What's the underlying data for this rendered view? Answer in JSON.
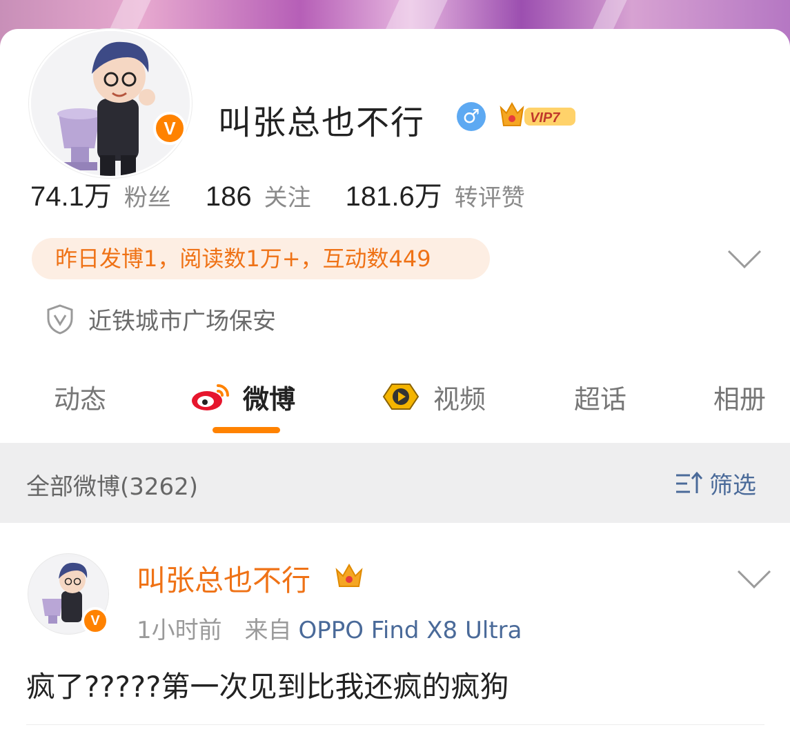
{
  "profile": {
    "name": "叫张总也不行",
    "gender_icon": "male-icon",
    "vip_label": "VIP7",
    "verified_badge": "V"
  },
  "stats": [
    {
      "value": "74.1万",
      "label": "粉丝"
    },
    {
      "value": "186",
      "label": "关注"
    },
    {
      "value": "181.6万",
      "label": "转评赞"
    }
  ],
  "activity_summary": "昨日发博1，阅读数1万+，互动数449",
  "job_title": "近铁城市广场保安",
  "tabs": [
    {
      "label": "动态",
      "icon": null
    },
    {
      "label": "微博",
      "icon": "weibo-logo-icon"
    },
    {
      "label": "视频",
      "icon": "video-play-icon"
    },
    {
      "label": "超话",
      "icon": null
    },
    {
      "label": "相册",
      "icon": null
    }
  ],
  "active_tab": "微博",
  "feed": {
    "title": "全部微博(3262)",
    "filter_label": "筛选"
  },
  "post": {
    "author": "叫张总也不行",
    "time": "1小时前",
    "source_prefix": "来自",
    "device": "OPPO Find X8 Ultra",
    "text": "疯了?????第一次见到比我还疯的疯狗"
  },
  "colors": {
    "accent": "#ff8200",
    "activity_bg": "#fdeee3",
    "activity_text": "#ef7216",
    "link": "#4a6a99",
    "gender": "#5da9f2"
  }
}
